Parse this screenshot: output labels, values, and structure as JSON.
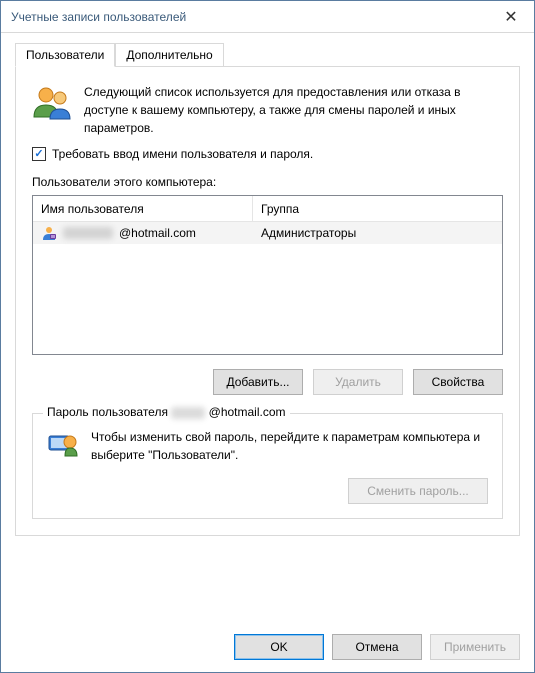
{
  "window": {
    "title": "Учетные записи пользователей"
  },
  "tabs": {
    "users": "Пользователи",
    "advanced": "Дополнительно"
  },
  "intro": "Следующий список используется для предоставления или отказа в доступе к вашему компьютеру, а также для смены паролей и иных параметров.",
  "require_login_checkbox": {
    "checked": true,
    "label": "Требовать ввод имени пользователя и пароля."
  },
  "users_label": "Пользователи этого компьютера:",
  "table": {
    "col_username": "Имя пользователя",
    "col_group": "Группа",
    "rows": [
      {
        "username": "@hotmail.com",
        "group": "Администраторы"
      }
    ]
  },
  "buttons": {
    "add": "Добавить...",
    "remove": "Удалить",
    "properties": "Свойства",
    "change_password": "Сменить пароль...",
    "ok": "OK",
    "cancel": "Отмена",
    "apply": "Применить"
  },
  "password_group": {
    "legend_prefix": "Пароль пользователя ",
    "legend_user": "@hotmail.com",
    "text": "Чтобы изменить свой пароль, перейдите к параметрам компьютера и выберите \"Пользователи\"."
  }
}
